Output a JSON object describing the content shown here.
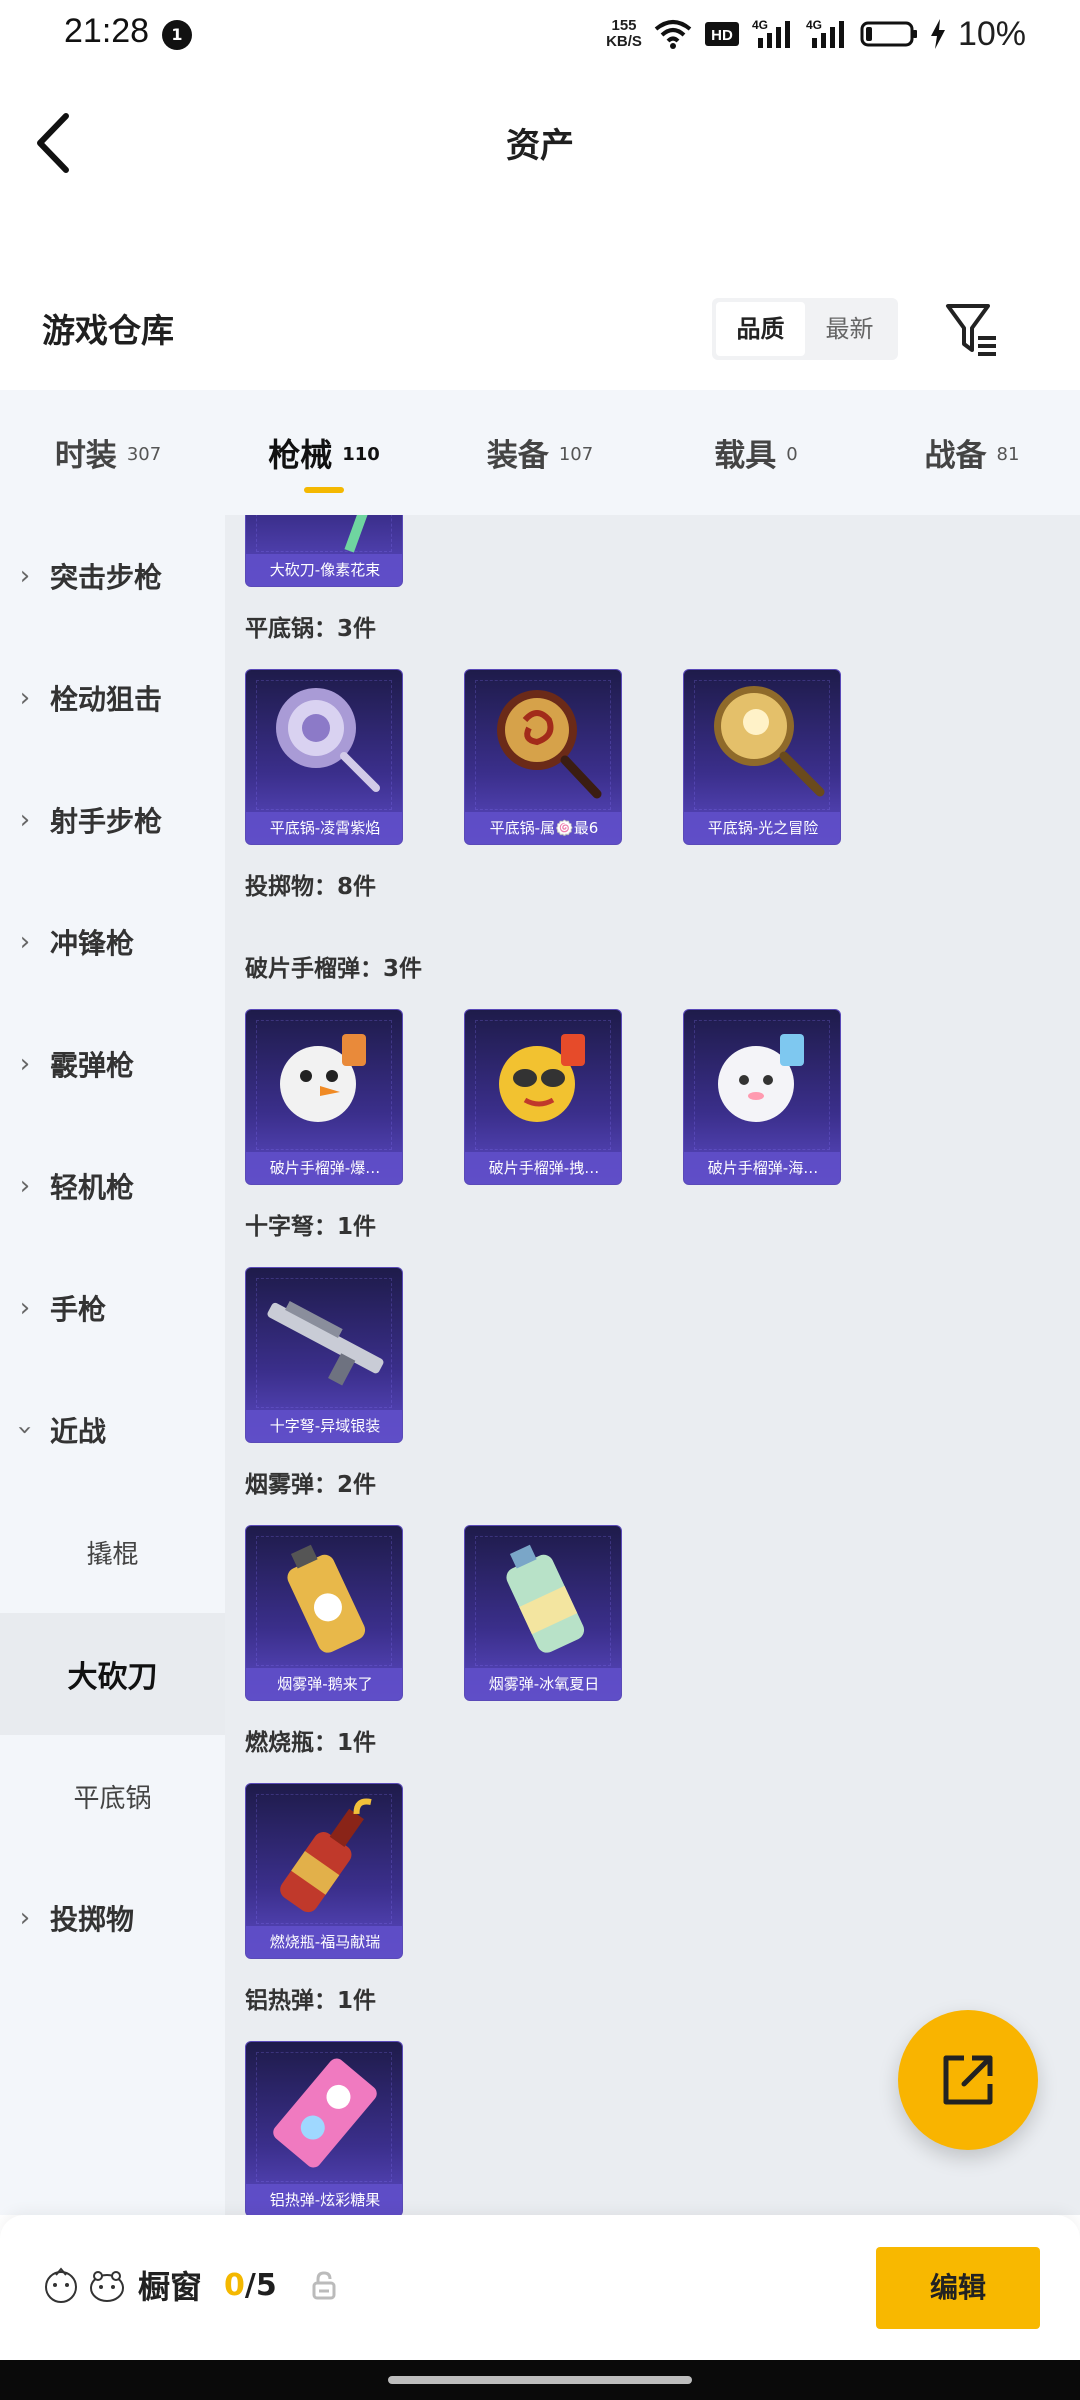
{
  "status_bar": {
    "time": "21:28",
    "notification_count": "1",
    "net_speed_value": "155",
    "net_speed_unit": "KB/S",
    "hd_label": "HD",
    "network_1": "4G",
    "network_2": "4G",
    "battery": "10%"
  },
  "header": {
    "title": "资产"
  },
  "warehouse": {
    "title": "游戏仓库",
    "sort_options": [
      "品质",
      "最新"
    ],
    "active_sort": "品质"
  },
  "tabs": [
    {
      "label": "时装",
      "count": "307"
    },
    {
      "label": "枪械",
      "count": "110",
      "active": true
    },
    {
      "label": "装备",
      "count": "107"
    },
    {
      "label": "载具",
      "count": "0"
    },
    {
      "label": "战备",
      "count": "81"
    }
  ],
  "sidebar": {
    "items": [
      {
        "label": "突击步枪"
      },
      {
        "label": "栓动狙击"
      },
      {
        "label": "射手步枪"
      },
      {
        "label": "冲锋枪"
      },
      {
        "label": "霰弹枪"
      },
      {
        "label": "轻机枪"
      },
      {
        "label": "手枪"
      },
      {
        "label": "近战",
        "expanded": true
      },
      {
        "label": "投掷物"
      }
    ],
    "subitems": [
      {
        "label": "撬棍"
      },
      {
        "label": "大砍刀",
        "active": true
      },
      {
        "label": "平底锅"
      }
    ]
  },
  "content": {
    "partial_card": "大砍刀-像素花束",
    "sections": [
      {
        "title": "平底锅：3件",
        "items": [
          "平底锅-凌霄紫焰",
          "平底锅-属🍥最6",
          "平底锅-光之冒险"
        ]
      },
      {
        "title": "投掷物：8件"
      },
      {
        "title": "破片手榴弹：3件",
        "items": [
          "破片手榴弹-爆…",
          "破片手榴弹-拽…",
          "破片手榴弹-海…"
        ]
      },
      {
        "title": "十字弩：1件",
        "items": [
          "十字弩-异域银装"
        ]
      },
      {
        "title": "烟雾弹：2件",
        "items": [
          "烟雾弹-鹅来了",
          "烟雾弹-冰氧夏日"
        ]
      },
      {
        "title": "燃烧瓶：1件",
        "items": [
          "燃烧瓶-福马献瑞"
        ]
      },
      {
        "title": "铝热弹：1件",
        "items": [
          "铝热弹-炫彩糖果"
        ]
      }
    ]
  },
  "bottom_bar": {
    "showcase_label": "橱窗",
    "current": "0",
    "separator": "/",
    "total": "5",
    "edit_label": "编辑"
  },
  "colors": {
    "accent": "#f8b800",
    "card_bg": "#3b2f8c",
    "card_label_bg": "#5f4ec8"
  },
  "icons": [
    "back-arrow-icon",
    "filter-icon",
    "chevron-right-icon",
    "chevron-down-icon",
    "share-out-icon",
    "lock-icon",
    "wifi-icon",
    "signal-icon",
    "battery-icon"
  ]
}
